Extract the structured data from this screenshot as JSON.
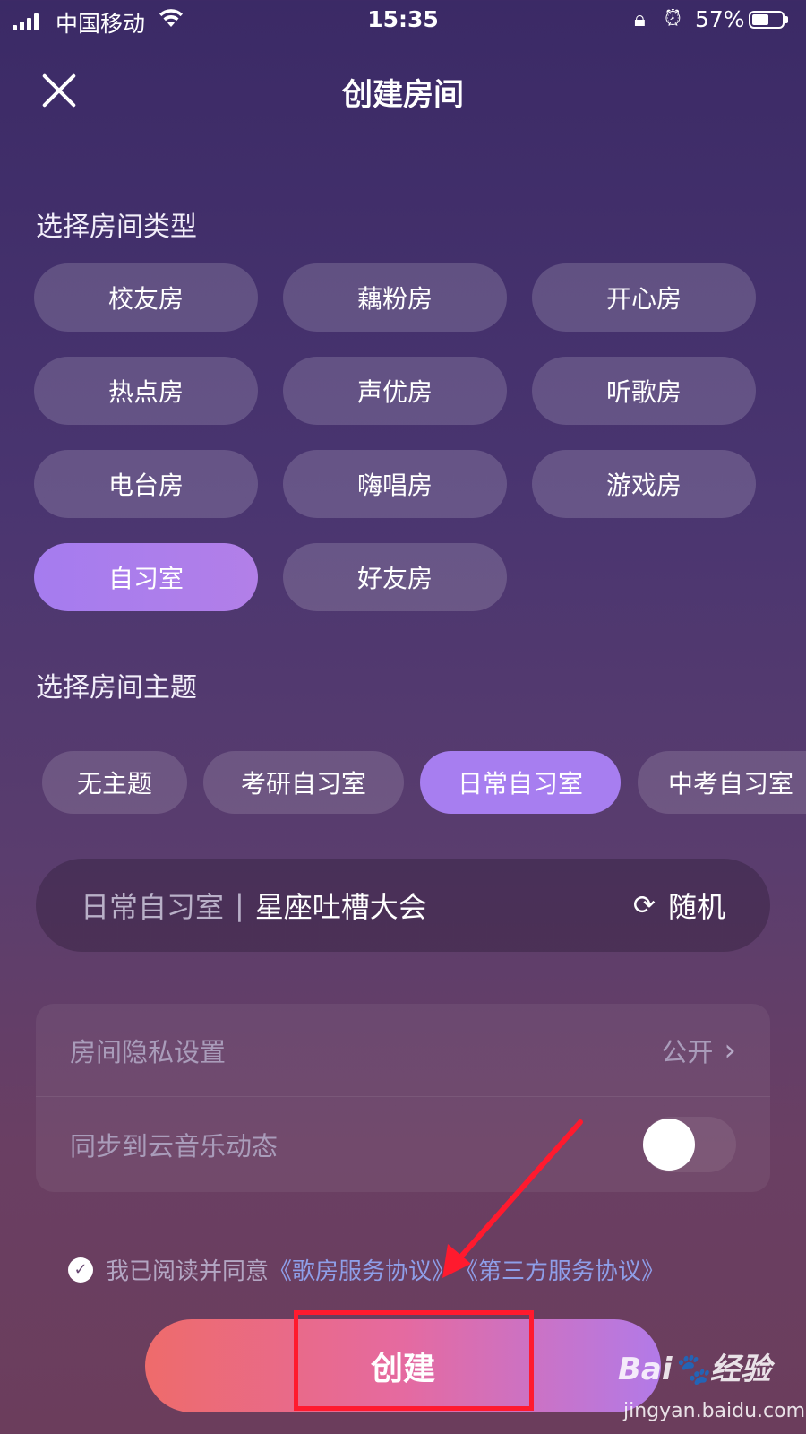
{
  "status_bar": {
    "carrier": "中国移动",
    "time": "15:35",
    "battery_percent": "57%",
    "battery_level": 0.57,
    "icons": [
      "signal-icon",
      "wifi-icon",
      "rotation-lock-icon",
      "alarm-icon",
      "battery-icon"
    ]
  },
  "header": {
    "title": "创建房间",
    "close_icon": "close-icon"
  },
  "room_type": {
    "label": "选择房间类型",
    "options": [
      "校友房",
      "藕粉房",
      "开心房",
      "热点房",
      "声优房",
      "听歌房",
      "电台房",
      "嗨唱房",
      "游戏房",
      "自习室",
      "好友房"
    ],
    "selected": "自习室"
  },
  "room_theme": {
    "label": "选择房间主题",
    "options": [
      "无主题",
      "考研自习室",
      "日常自习室",
      "中考自习室"
    ],
    "selected": "日常自习室"
  },
  "room_name": {
    "prefix": "日常自习室",
    "separator": "|",
    "name": "星座吐槽大会",
    "random_label": "随机",
    "random_icon": "refresh-icon"
  },
  "settings": {
    "privacy_label": "房间隐私设置",
    "privacy_value": "公开",
    "sync_label": "同步到云音乐动态",
    "sync_enabled": false
  },
  "agreement": {
    "text": "我已阅读并同意",
    "link1": "《歌房服务协议》",
    "link2": "《第三方服务协议》",
    "checked": true
  },
  "create_button": {
    "label": "创建"
  },
  "watermark": {
    "logo": "Bai🐾经验",
    "url": "jingyan.baidu.com"
  },
  "colors": {
    "accent": "#a77ef0",
    "create_start": "#ee6b6b",
    "create_end": "#b27ae8",
    "annotation_red": "#ff1a2e"
  }
}
